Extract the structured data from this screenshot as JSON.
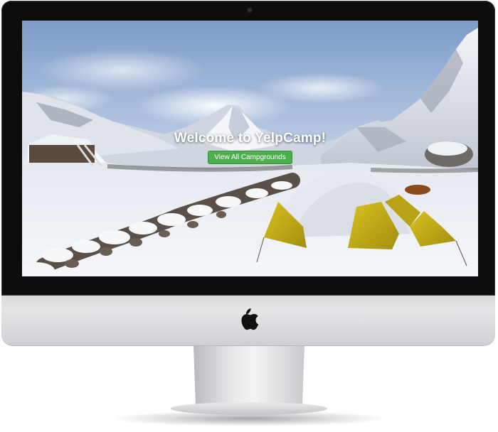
{
  "landing": {
    "title": "Welcome to YelpCamp!",
    "button_label": "View All Campgrounds"
  },
  "device": {
    "logo": "apple-icon",
    "camera": "camera-icon"
  },
  "colors": {
    "button": "#4cae4c",
    "bezel": "#0d0d0e",
    "sky": "#9fb6d6",
    "snow": "#eef2f8",
    "tent": "#c9b21a"
  }
}
